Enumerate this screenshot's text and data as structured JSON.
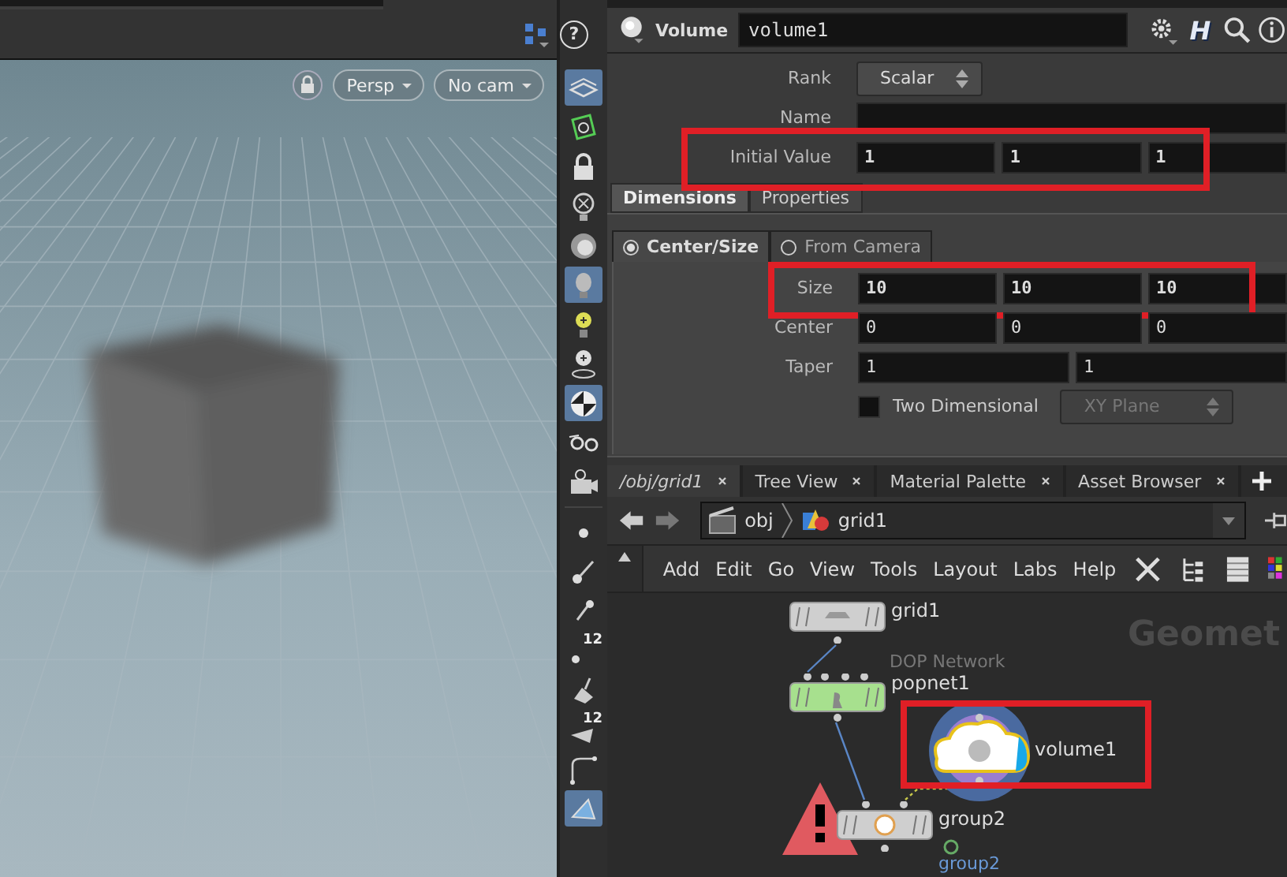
{
  "viewport": {
    "help_glyph": "?",
    "view_buttons": [
      {
        "label": "Persp"
      },
      {
        "label": "No cam"
      }
    ]
  },
  "viewport_toolbar": [
    {
      "kind": "display",
      "selected": true
    },
    {
      "kind": "ghost",
      "selected": false
    },
    {
      "kind": "lock",
      "selected": false
    },
    {
      "kind": "light-off",
      "selected": false
    },
    {
      "kind": "sphere",
      "selected": false
    },
    {
      "kind": "bulb",
      "selected": true
    },
    {
      "kind": "bulb-yellow",
      "selected": false
    },
    {
      "kind": "bulb-pin",
      "selected": false
    },
    {
      "kind": "shaded",
      "selected": true
    },
    {
      "kind": "glasses",
      "selected": false
    },
    {
      "kind": "camera",
      "selected": false
    },
    {
      "kind": "point",
      "selected": false
    },
    {
      "kind": "brush",
      "selected": false
    },
    {
      "kind": "pin",
      "selected": false
    },
    {
      "kind": "point-numbers",
      "selected": false,
      "badge": "12"
    },
    {
      "kind": "paint",
      "selected": false
    },
    {
      "kind": "prim-numbers",
      "selected": false,
      "badge": "12"
    },
    {
      "kind": "curve",
      "selected": false
    },
    {
      "kind": "shape",
      "selected": true
    }
  ],
  "parameters": {
    "node_type": "Volume",
    "node_name": "volume1",
    "logo_glyph": "H",
    "rows": [
      {
        "kind": "menu",
        "label": "Rank",
        "value": "Scalar",
        "highlighted": false
      },
      {
        "kind": "text",
        "label": "Name",
        "highlighted": false
      },
      {
        "kind": "vector",
        "label": "Initial Value",
        "values": [
          "1",
          "1",
          "1"
        ],
        "bold": true,
        "highlighted": true
      }
    ],
    "tabs": [
      {
        "label": "Dimensions",
        "selected": true
      },
      {
        "label": "Properties",
        "selected": false
      }
    ],
    "modes": [
      {
        "label": "Center/Size",
        "selected": true
      },
      {
        "label": "From Camera",
        "selected": false
      }
    ],
    "mode_rows": [
      {
        "kind": "vector",
        "label": "Size",
        "values": [
          "10",
          "10",
          "10"
        ],
        "bold": true,
        "highlighted": true
      },
      {
        "kind": "vector",
        "label": "Center",
        "values": [
          "0",
          "0",
          "0"
        ],
        "bold": false,
        "highlighted": false
      },
      {
        "kind": "vector",
        "label": "Taper",
        "values": [
          "1",
          "1"
        ],
        "bold": false,
        "highlighted": false
      },
      {
        "kind": "toggle",
        "label": "Two Dimensional",
        "checked": false,
        "menu_value": "XY Plane",
        "menu_disabled": true,
        "highlighted": false
      }
    ]
  },
  "pane_tabs": [
    {
      "label": "/obj/grid1",
      "selected": true
    },
    {
      "label": "Tree View",
      "selected": false
    },
    {
      "label": "Material Palette",
      "selected": false
    },
    {
      "label": "Asset Browser",
      "selected": false
    }
  ],
  "path_bar": {
    "crumbs": [
      "obj",
      "grid1"
    ]
  },
  "network_menu": [
    "Add",
    "Edit",
    "Go",
    "View",
    "Tools",
    "Layout",
    "Labs",
    "Help"
  ],
  "network": {
    "context_label": "Geomet",
    "nodes": [
      {
        "kind": "grid",
        "name": "grid1"
      },
      {
        "kind": "dop",
        "type_label": "DOP Network",
        "name": "popnet1"
      },
      {
        "kind": "volume",
        "name": "volume1",
        "highlighted": true
      },
      {
        "kind": "group",
        "name": "group2",
        "error": true,
        "group_label": "group2"
      }
    ]
  }
}
